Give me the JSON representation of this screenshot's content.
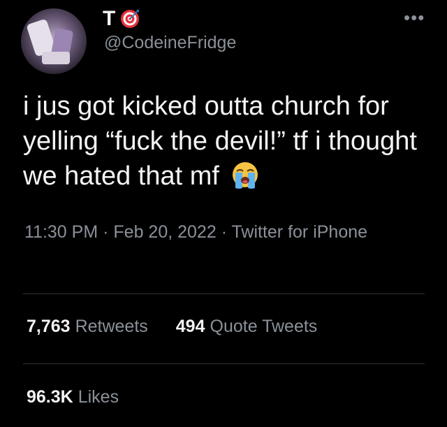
{
  "author": {
    "display_name": "T",
    "handle": "@CodeineFridge"
  },
  "tweet": {
    "text": "i jus got kicked outta church for yelling “fuck the devil!” tf i thought we hated that mf",
    "emoji": "loudly-crying-face"
  },
  "meta": {
    "time": "11:30 PM",
    "separator": "·",
    "date": "Feb 20, 2022",
    "source": "Twitter for iPhone"
  },
  "stats": {
    "retweets": {
      "value": "7,763",
      "label": "Retweets"
    },
    "quote_tweets": {
      "value": "494",
      "label": "Quote Tweets"
    },
    "likes": {
      "value": "96.3K",
      "label": "Likes"
    }
  },
  "icons": {
    "name_badge": "direct-hit-target-icon",
    "menu": "more-dots-icon"
  },
  "colors": {
    "background": "#000000",
    "primary_text": "#f4f4f4",
    "secondary_text": "#8b9199",
    "divider": "#2f3336"
  }
}
